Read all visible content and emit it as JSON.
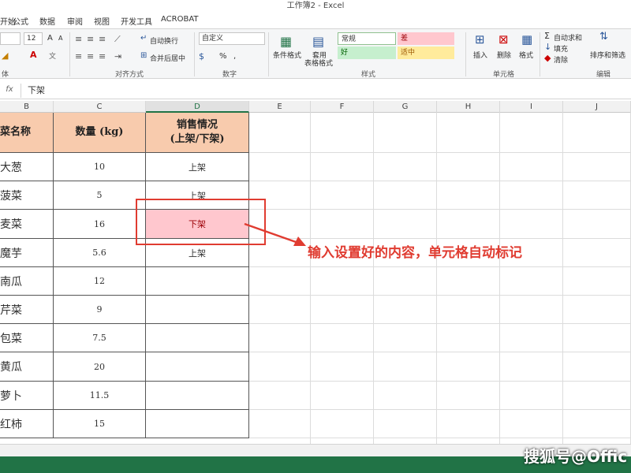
{
  "window": {
    "title": "工作簿2 - Excel"
  },
  "tabs": [
    "开始",
    "公式",
    "数据",
    "审阅",
    "视图",
    "开发工具",
    "ACROBAT"
  ],
  "ribbon": {
    "font_size": "12",
    "font_grow": "A",
    "font_shrink": "A",
    "wrap_text": "自动换行",
    "merge_center": "合并后居中",
    "number_format": "自定义",
    "percent": "%",
    "comma": ",",
    "conditional_format": "条件格式",
    "format_as_table_1": "套用",
    "format_as_table_2": "表格格式",
    "styles": {
      "normal": "常规",
      "bad": "差",
      "good": "好",
      "neutral": "适中"
    },
    "insert": "插入",
    "delete": "删除",
    "format": "格式",
    "autosum": "自动求和",
    "fill": "填充",
    "clear": "清除",
    "sort_filter": "排序和筛选",
    "groups": {
      "font": "体",
      "alignment": "对齐方式",
      "number": "数字",
      "styles": "样式",
      "cells": "单元格",
      "editing": "编辑"
    }
  },
  "formula_bar": {
    "fx": "fx",
    "content": "下架"
  },
  "columns": [
    "B",
    "C",
    "D",
    "E",
    "F",
    "G",
    "H",
    "I",
    "J"
  ],
  "table": {
    "headers": {
      "name": "菜名称",
      "qty": "数量 (kg)",
      "status_1": "销售情况",
      "status_2": "(上架/下架)"
    },
    "rows": [
      {
        "name": "大葱",
        "qty": "10",
        "status": "上架"
      },
      {
        "name": "菠菜",
        "qty": "5",
        "status": "上架"
      },
      {
        "name": "麦菜",
        "qty": "16",
        "status": "下架"
      },
      {
        "name": "魔芋",
        "qty": "5.6",
        "status": "上架"
      },
      {
        "name": "南瓜",
        "qty": "12",
        "status": ""
      },
      {
        "name": "芹菜",
        "qty": "9",
        "status": ""
      },
      {
        "name": "包菜",
        "qty": "7.5",
        "status": ""
      },
      {
        "name": "黄瓜",
        "qty": "20",
        "status": ""
      },
      {
        "name": "萝卜",
        "qty": "11.5",
        "status": ""
      },
      {
        "name": "红柿",
        "qty": "15",
        "status": ""
      }
    ]
  },
  "annotation": "输入设置好的内容，单元格自动标记",
  "watermark": "搜狐号@Offic",
  "colors": {
    "header_fill": "#f8cbad",
    "bad_fill": "#ffc7ce",
    "bad_text": "#9c0006",
    "annotation": "#e03c31",
    "excel_green": "#217346"
  }
}
